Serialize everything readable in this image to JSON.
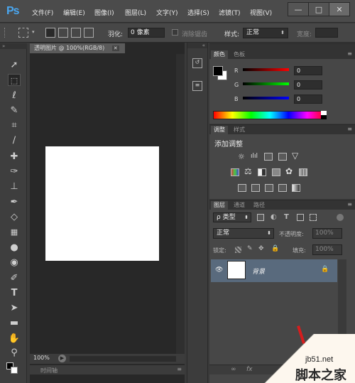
{
  "app": {
    "logo": "Ps"
  },
  "menu": [
    "文件(F)",
    "编辑(E)",
    "图像(I)",
    "图层(L)",
    "文字(Y)",
    "选择(S)",
    "滤镜(T)",
    "视图(V)"
  ],
  "window_controls": {
    "minimize": "—",
    "restore": "□",
    "close": "✕"
  },
  "options": {
    "feather_label": "羽化:",
    "feather_value": "0 像素",
    "antialias_label": "消除锯齿",
    "style_label": "样式:",
    "style_value": "正常",
    "width_label": "宽度:"
  },
  "document": {
    "tab_title": "透明图片 @ 100%(RGB/8)",
    "tab_close": "✕",
    "zoom": "100%",
    "timeline_label": "时间轴"
  },
  "color_panel": {
    "tabs": [
      "颜色",
      "色板"
    ],
    "channels": [
      {
        "label": "R",
        "value": "0"
      },
      {
        "label": "G",
        "value": "0"
      },
      {
        "label": "B",
        "value": "0"
      }
    ]
  },
  "adjust_panel": {
    "tabs": [
      "调整",
      "样式"
    ],
    "heading": "添加调整"
  },
  "layers_panel": {
    "tabs": [
      "图层",
      "通道",
      "路径"
    ],
    "filter_kind": "ρ 类型",
    "blend_mode": "正常",
    "opacity_label": "不透明度:",
    "opacity_value": "100%",
    "lock_label": "锁定:",
    "fill_label": "填充:",
    "fill_value": "100%",
    "layers": [
      {
        "name": "背景",
        "visible": true,
        "locked": true
      }
    ],
    "footer_icons": [
      "link-icon",
      "fx-icon"
    ]
  },
  "watermark": {
    "site": "jb51.net",
    "name": "脚本之家"
  },
  "colors": {
    "menu_bg": "#4b4b4b",
    "panel_bg": "#474747",
    "workspace_bg": "#282828",
    "layer_selected": "#596a7d",
    "ps_blue": "#4aa7f0"
  }
}
